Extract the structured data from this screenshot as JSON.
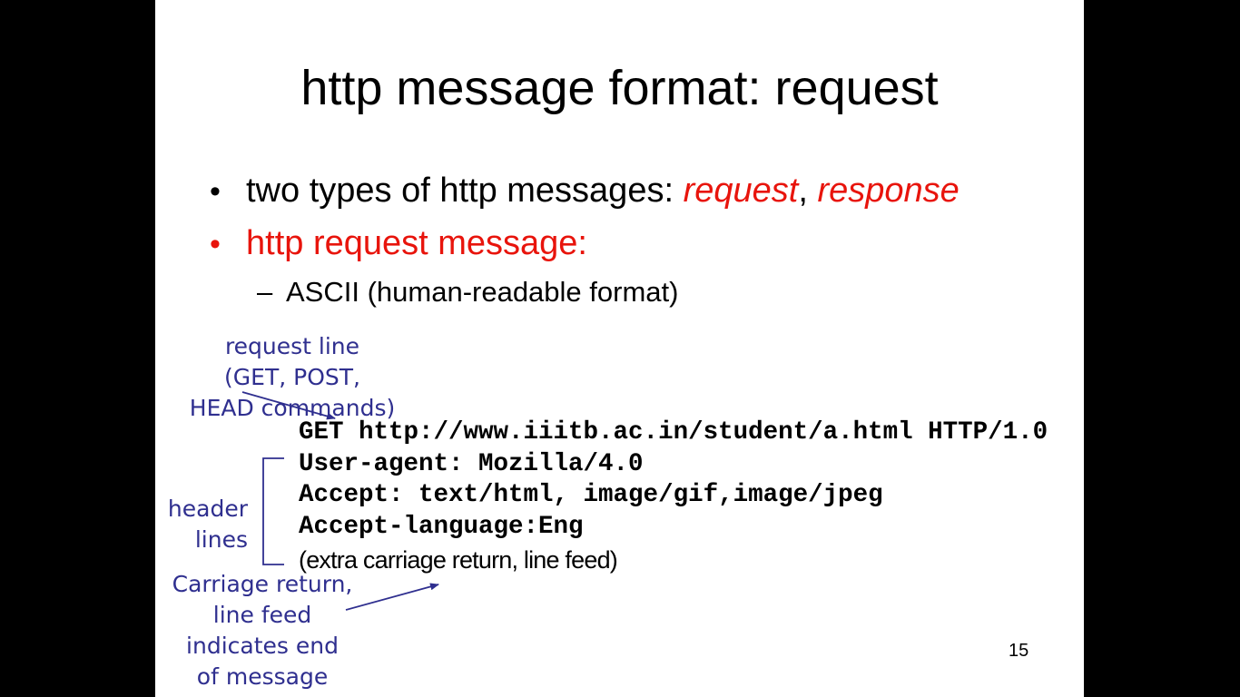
{
  "slide": {
    "title": "http message format: request",
    "bullets": [
      {
        "prefix": "two types of http messages: ",
        "em1": "request",
        "sep": ", ",
        "em2": "response"
      },
      {
        "text": "http request message:"
      }
    ],
    "sub_bullet": "ASCII (human-readable format)",
    "bullet_glyph": "•",
    "dash_glyph": "–",
    "annotations": {
      "request_line": [
        "request line",
        "(GET, POST,",
        "HEAD commands)"
      ],
      "header_lines": [
        "header",
        "lines"
      ],
      "crlf": [
        "Carriage return,",
        "line feed",
        "indicates end",
        "of message"
      ]
    },
    "code_lines": [
      "GET http://www.iiitb.ac.in/student/a.html HTTP/1.0",
      "User-agent: Mozilla/4.0",
      "Accept: text/html, image/gif,image/jpeg",
      "Accept-language:Eng"
    ],
    "extra_line": "(extra carriage return, line feed)",
    "page_number": "15"
  },
  "colors": {
    "background": "#000000",
    "slide_background": "#ffffff",
    "accent_red": "#e8140c",
    "annotation_blue": "#2f2f8f"
  }
}
